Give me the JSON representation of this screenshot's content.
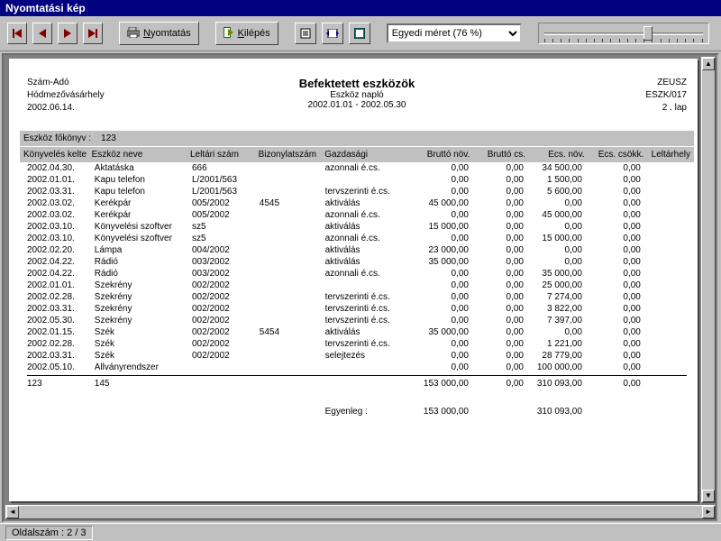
{
  "window": {
    "title": "Nyomtatási kép"
  },
  "toolbar": {
    "print": "Nyomtatás",
    "exit": "Kilépés",
    "zoom_selected": "Egyedi méret (76 %)"
  },
  "status": {
    "page_label": "Oldalszám :",
    "page_value": "2 / 3"
  },
  "report": {
    "org1": "Szám-Adó",
    "org2": "Hódmezővásárhely",
    "date": "2002.06.14.",
    "title": "Befektetett eszközök",
    "subtitle": "Eszköz napló",
    "period": "2002.01.01 - 2002.05.30",
    "right1": "ZEUSZ",
    "right2": "ESZK/017",
    "right3": "2 . lap",
    "ledger_label": "Eszköz főkönyv :",
    "ledger_value": "123",
    "columns": [
      "Könyvelés kelte",
      "Eszköz neve",
      "Leltári szám",
      "Bizonylatszám",
      "Gazdasági",
      "Bruttó növ.",
      "Bruttó cs.",
      "Écs. növ.",
      "Écs. csökk.",
      "Leltárhely"
    ],
    "rows": [
      [
        "2002.04.30.",
        "Aktatáska",
        "666",
        "",
        "azonnali é.cs.",
        "0,00",
        "0,00",
        "34 500,00",
        "0,00",
        ""
      ],
      [
        "2002.01.01.",
        "Kapu telefon",
        "L/2001/563",
        "",
        "",
        "0,00",
        "0,00",
        "1 500,00",
        "0,00",
        ""
      ],
      [
        "2002.03.31.",
        "Kapu telefon",
        "L/2001/563",
        "",
        "tervszerinti é.cs.",
        "0,00",
        "0,00",
        "5 600,00",
        "0,00",
        ""
      ],
      [
        "2002.03.02.",
        "Kerékpár",
        "005/2002",
        "4545",
        "aktiválás",
        "45 000,00",
        "0,00",
        "0,00",
        "0,00",
        ""
      ],
      [
        "2002.03.02.",
        "Kerékpár",
        "005/2002",
        "",
        "azonnali é.cs.",
        "0,00",
        "0,00",
        "45 000,00",
        "0,00",
        ""
      ],
      [
        "2002.03.10.",
        "Könyvelési szoftver",
        "sz5",
        "",
        "aktiválás",
        "15 000,00",
        "0,00",
        "0,00",
        "0,00",
        ""
      ],
      [
        "2002.03.10.",
        "Könyvelési szoftver",
        "sz5",
        "",
        "azonnali é.cs.",
        "0,00",
        "0,00",
        "15 000,00",
        "0,00",
        ""
      ],
      [
        "2002.02.20.",
        "Lámpa",
        "004/2002",
        "",
        "aktiválás",
        "23 000,00",
        "0,00",
        "0,00",
        "0,00",
        ""
      ],
      [
        "2002.04.22.",
        "Rádió",
        "003/2002",
        "",
        "aktiválás",
        "35 000,00",
        "0,00",
        "0,00",
        "0,00",
        ""
      ],
      [
        "2002.04.22.",
        "Rádió",
        "003/2002",
        "",
        "azonnali é.cs.",
        "0,00",
        "0,00",
        "35 000,00",
        "0,00",
        ""
      ],
      [
        "2002.01.01.",
        "Szekrény",
        "002/2002",
        "",
        "",
        "0,00",
        "0,00",
        "25 000,00",
        "0,00",
        ""
      ],
      [
        "2002.02.28.",
        "Szekrény",
        "002/2002",
        "",
        "tervszerinti é.cs.",
        "0,00",
        "0,00",
        "7 274,00",
        "0,00",
        ""
      ],
      [
        "2002.03.31.",
        "Szekrény",
        "002/2002",
        "",
        "tervszerinti é.cs.",
        "0,00",
        "0,00",
        "3 822,00",
        "0,00",
        ""
      ],
      [
        "2002.05.30.",
        "Szekrény",
        "002/2002",
        "",
        "tervszerinti é.cs.",
        "0,00",
        "0,00",
        "7 397,00",
        "0,00",
        ""
      ],
      [
        "2002.01.15.",
        "Szék",
        "002/2002",
        "5454",
        "aktiválás",
        "35 000,00",
        "0,00",
        "0,00",
        "0,00",
        ""
      ],
      [
        "2002.02.28.",
        "Szék",
        "002/2002",
        "",
        "tervszerinti é.cs.",
        "0,00",
        "0,00",
        "1 221,00",
        "0,00",
        ""
      ],
      [
        "2002.03.31.",
        "Szék",
        "002/2002",
        "",
        "selejtezés",
        "0,00",
        "0,00",
        "28 779,00",
        "0,00",
        ""
      ],
      [
        "2002.05.10.",
        "Állványrendszer",
        "",
        "",
        "",
        "0,00",
        "0,00",
        "100 000,00",
        "0,00",
        ""
      ]
    ],
    "totals": [
      "123",
      "145",
      "",
      "",
      "",
      "153 000,00",
      "0,00",
      "310 093,00",
      "0,00",
      ""
    ],
    "balance_label": "Egyenleg :",
    "balance": [
      "",
      "",
      "",
      "",
      "",
      "153 000,00",
      "",
      "310 093,00",
      "",
      ""
    ]
  }
}
